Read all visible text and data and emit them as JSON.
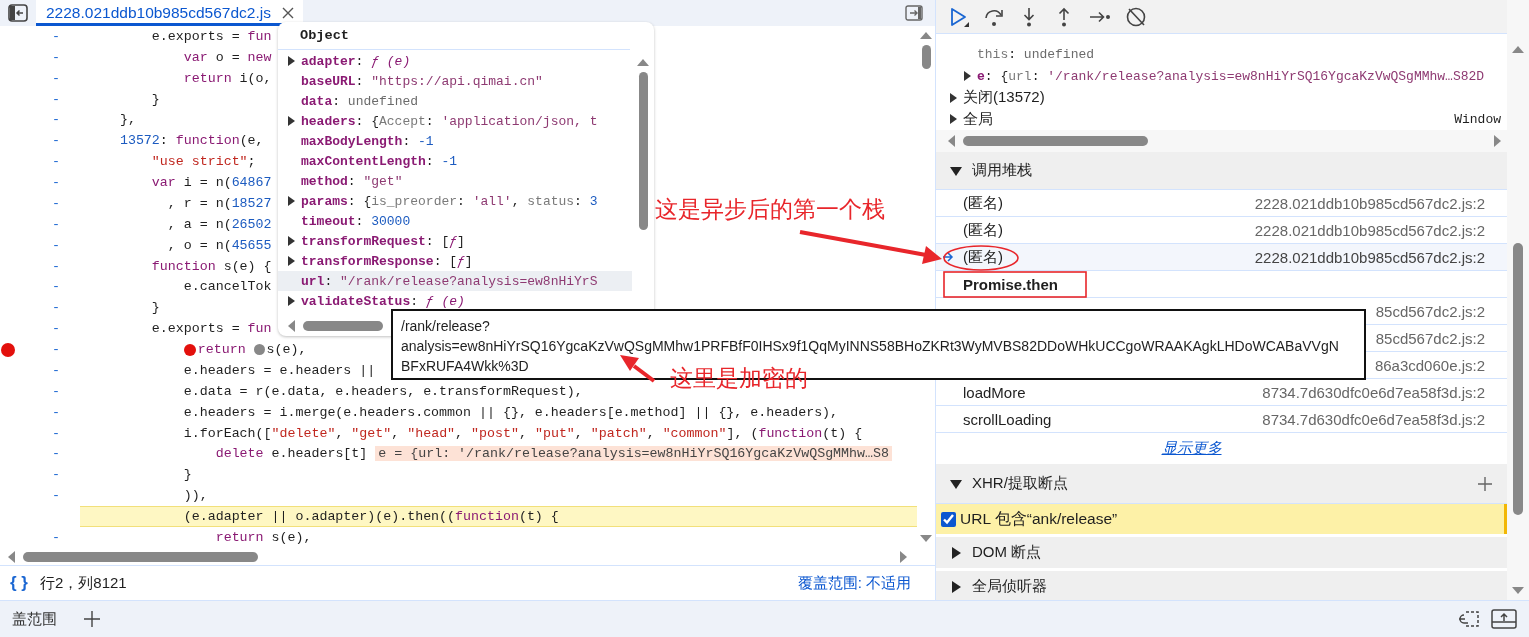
{
  "editor_tab": {
    "label": "2228.021ddb10b985cd567dc2.js",
    "selected": true
  },
  "code_lines": [
    {
      "gutter": "-",
      "current": false,
      "tokens": [
        {
          "kind": "p",
          "s": "        e.exports = "
        },
        {
          "kind": "kw",
          "s": "fun"
        }
      ]
    },
    {
      "gutter": "-",
      "current": false,
      "tokens": [
        {
          "kind": "kw",
          "s": "            var"
        },
        {
          "kind": "p",
          "s": " o = "
        },
        {
          "kind": "kw",
          "s": "new"
        }
      ]
    },
    {
      "gutter": "-",
      "current": false,
      "tokens": [
        {
          "kind": "kw",
          "s": "            return"
        },
        {
          "kind": "p",
          "s": " i(o,"
        }
      ]
    },
    {
      "gutter": "-",
      "current": false,
      "tokens": [
        {
          "kind": "p",
          "s": "        }"
        }
      ]
    },
    {
      "gutter": "-",
      "current": false,
      "tokens": [
        {
          "kind": "p",
          "s": "    },"
        }
      ]
    },
    {
      "gutter": "-",
      "current": false,
      "tokens": [
        {
          "kind": "num",
          "s": "    13572"
        },
        {
          "kind": "p",
          "s": ": "
        },
        {
          "kind": "kw",
          "s": "function"
        },
        {
          "kind": "p",
          "s": "(e,"
        }
      ]
    },
    {
      "gutter": "-",
      "current": false,
      "tokens": [
        {
          "kind": "str",
          "s": "        \"use strict\""
        },
        {
          "kind": "p",
          "s": ";"
        }
      ]
    },
    {
      "gutter": "-",
      "current": false,
      "tokens": [
        {
          "kind": "kw",
          "s": "        var"
        },
        {
          "kind": "p",
          "s": " i = n("
        },
        {
          "kind": "num",
          "s": "64867"
        }
      ]
    },
    {
      "gutter": "-",
      "current": false,
      "tokens": [
        {
          "kind": "p",
          "s": "          , r = n("
        },
        {
          "kind": "num",
          "s": "18527"
        }
      ]
    },
    {
      "gutter": "-",
      "current": false,
      "tokens": [
        {
          "kind": "p",
          "s": "          , a = n("
        },
        {
          "kind": "num",
          "s": "26502"
        }
      ]
    },
    {
      "gutter": "-",
      "current": false,
      "tokens": [
        {
          "kind": "p",
          "s": "          , o = n("
        },
        {
          "kind": "num",
          "s": "45655"
        }
      ]
    },
    {
      "gutter": "-",
      "current": false,
      "tokens": [
        {
          "kind": "kw",
          "s": "        function"
        },
        {
          "kind": "p",
          "s": " s(e) {"
        }
      ]
    },
    {
      "gutter": "-",
      "current": false,
      "tokens": [
        {
          "kind": "p",
          "s": "            e.cancelTok"
        }
      ]
    },
    {
      "gutter": "-",
      "current": false,
      "tokens": [
        {
          "kind": "p",
          "s": "        }"
        }
      ]
    },
    {
      "gutter": "-",
      "current": false,
      "tokens": [
        {
          "kind": "p",
          "s": "        e.exports = "
        },
        {
          "kind": "kw",
          "s": "fun"
        }
      ]
    },
    {
      "gutter": "-",
      "current": false,
      "tokens": [
        {
          "kind": "bp"
        },
        {
          "kind": "kw",
          "s": "return "
        },
        {
          "kind": "bpg"
        },
        {
          "kind": "p",
          "s": "s(e),"
        }
      ]
    },
    {
      "gutter": "-",
      "current": false,
      "tokens": [
        {
          "kind": "p",
          "s": "            e.headers = e.headers ||"
        }
      ]
    },
    {
      "gutter": "-",
      "current": false,
      "tokens": [
        {
          "kind": "p",
          "s": "            e.data = r(e.data, e.headers, e.transformRequest),"
        }
      ]
    },
    {
      "gutter": "-",
      "current": false,
      "tokens": [
        {
          "kind": "p",
          "s": "            e.headers = i.merge(e.headers.common || {}, e.headers[e.method] || {}, e.headers),"
        }
      ]
    },
    {
      "gutter": "-",
      "current": false,
      "tokens": [
        {
          "kind": "p",
          "s": "            i.forEach(["
        },
        {
          "kind": "str",
          "s": "\"delete\""
        },
        {
          "kind": "p",
          "s": ", "
        },
        {
          "kind": "str",
          "s": "\"get\""
        },
        {
          "kind": "p",
          "s": ", "
        },
        {
          "kind": "str",
          "s": "\"head\""
        },
        {
          "kind": "p",
          "s": ", "
        },
        {
          "kind": "str",
          "s": "\"post\""
        },
        {
          "kind": "p",
          "s": ", "
        },
        {
          "kind": "str",
          "s": "\"put\""
        },
        {
          "kind": "p",
          "s": ", "
        },
        {
          "kind": "str",
          "s": "\"patch\""
        },
        {
          "kind": "p",
          "s": ", "
        },
        {
          "kind": "str",
          "s": "\"common\""
        },
        {
          "kind": "p",
          "s": "], ("
        },
        {
          "kind": "kw",
          "s": "function"
        },
        {
          "kind": "p",
          "s": "(t) {"
        }
      ]
    },
    {
      "gutter": "-",
      "current": false,
      "tokens": [
        {
          "kind": "kw",
          "s": "                delete"
        },
        {
          "kind": "p",
          "s": " e.headers[t]"
        },
        {
          "kind": "val",
          "s": "e = {url: '/rank/release?analysis=ew8nHiYrSQ16YgcaKzVwQSgMMhw…S8"
        }
      ]
    },
    {
      "gutter": "-",
      "current": false,
      "tokens": [
        {
          "kind": "p",
          "s": "            }"
        }
      ]
    },
    {
      "gutter": "-",
      "current": false,
      "tokens": [
        {
          "kind": "p",
          "s": "            )),"
        }
      ]
    },
    {
      "current": true,
      "tokens": [
        {
          "kind": "p",
          "s": "            (e.adapter || o.adapter)(e).then(("
        },
        {
          "kind": "kw",
          "s": "function"
        },
        {
          "kind": "p",
          "s": "(t) {"
        }
      ]
    },
    {
      "gutter": "-",
      "current": false,
      "tokens": [
        {
          "kind": "kw",
          "s": "                return"
        },
        {
          "kind": "p",
          "s": " s(e),"
        }
      ]
    }
  ],
  "status_bar": {
    "pretty_print": "{ }",
    "position": "行2，列8121",
    "coverage": "覆盖范围: 不适用"
  },
  "drawer": {
    "tab": "盖范围"
  },
  "object_popover": {
    "title": "Object",
    "properties": [
      {
        "name": "adapter",
        "expandable": true,
        "selected": false,
        "tokens": [
          {
            "kind": "p",
            "s": ": "
          },
          {
            "kind": "fn",
            "s": "ƒ (e)"
          }
        ]
      },
      {
        "name": "baseURL",
        "expandable": false,
        "selected": false,
        "tokens": [
          {
            "kind": "p",
            "s": ": "
          },
          {
            "kind": "str",
            "s": "\"https://api.qimai.cn\""
          }
        ]
      },
      {
        "name": "data",
        "expandable": false,
        "selected": false,
        "tokens": [
          {
            "kind": "p",
            "s": ": "
          },
          {
            "kind": "undef",
            "s": "undefined"
          }
        ]
      },
      {
        "name": "headers",
        "expandable": true,
        "selected": false,
        "tokens": [
          {
            "kind": "p",
            "s": ": {"
          },
          {
            "kind": "key",
            "s": "Accept"
          },
          {
            "kind": "p",
            "s": ": "
          },
          {
            "kind": "str",
            "s": "'application/json, t"
          }
        ]
      },
      {
        "name": "maxBodyLength",
        "expandable": false,
        "selected": false,
        "tokens": [
          {
            "kind": "p",
            "s": ": "
          },
          {
            "kind": "num",
            "s": "-1"
          }
        ]
      },
      {
        "name": "maxContentLength",
        "expandable": false,
        "selected": false,
        "tokens": [
          {
            "kind": "p",
            "s": ": "
          },
          {
            "kind": "num",
            "s": "-1"
          }
        ]
      },
      {
        "name": "method",
        "expandable": false,
        "selected": false,
        "tokens": [
          {
            "kind": "p",
            "s": ": "
          },
          {
            "kind": "str",
            "s": "\"get\""
          }
        ]
      },
      {
        "name": "params",
        "expandable": true,
        "selected": false,
        "tokens": [
          {
            "kind": "p",
            "s": ": {"
          },
          {
            "kind": "key",
            "s": "is_preorder"
          },
          {
            "kind": "p",
            "s": ": "
          },
          {
            "kind": "str",
            "s": "'all'"
          },
          {
            "kind": "p",
            "s": ", "
          },
          {
            "kind": "key",
            "s": "status"
          },
          {
            "kind": "p",
            "s": ": "
          },
          {
            "kind": "num",
            "s": "3"
          }
        ]
      },
      {
        "name": "timeout",
        "expandable": false,
        "selected": false,
        "tokens": [
          {
            "kind": "p",
            "s": ": "
          },
          {
            "kind": "num",
            "s": "30000"
          }
        ]
      },
      {
        "name": "transformRequest",
        "expandable": true,
        "selected": false,
        "tokens": [
          {
            "kind": "p",
            "s": ": ["
          },
          {
            "kind": "fn",
            "s": "ƒ"
          },
          {
            "kind": "p",
            "s": "]"
          }
        ]
      },
      {
        "name": "transformResponse",
        "expandable": true,
        "selected": false,
        "tokens": [
          {
            "kind": "p",
            "s": ": ["
          },
          {
            "kind": "fn",
            "s": "ƒ"
          },
          {
            "kind": "p",
            "s": "]"
          }
        ]
      },
      {
        "name": "url",
        "expandable": false,
        "selected": true,
        "tokens": [
          {
            "kind": "p",
            "s": ": "
          },
          {
            "kind": "str",
            "s": "\"/rank/release?analysis=ew8nHiYrS"
          }
        ]
      },
      {
        "name": "validateStatus",
        "expandable": true,
        "selected": false,
        "tokens": [
          {
            "kind": "p",
            "s": ": "
          },
          {
            "kind": "fn",
            "s": "ƒ (e)"
          }
        ]
      }
    ]
  },
  "scope": [
    {
      "kind": "value",
      "name": "this",
      "expandable": false,
      "tokens": [
        {
          "kind": "p",
          "s": ": "
        },
        {
          "kind": "undef",
          "s": "undefined"
        }
      ]
    },
    {
      "kind": "value",
      "name": "e",
      "expandable": true,
      "tokens": [
        {
          "kind": "p",
          "s": ": {"
        },
        {
          "kind": "key",
          "s": "url"
        },
        {
          "kind": "p",
          "s": ": "
        },
        {
          "kind": "str",
          "s": "'/rank/release?analysis=ew8nHiYrSQ16YgcaKzVwQSgMMhw…S82D"
        }
      ]
    },
    {
      "kind": "scope",
      "label": "关闭(13572)",
      "expandable": true
    },
    {
      "kind": "scope",
      "label": "全局",
      "value": "Window",
      "expandable": true
    }
  ],
  "call_stack": {
    "title": "调用堆栈",
    "expanded": true,
    "frames": [
      {
        "kind": "frame",
        "name": "(匿名)",
        "location": "2228.021ddb10b985cd567dc2.js:2",
        "selected": false
      },
      {
        "kind": "frame",
        "name": "(匿名)",
        "location": "2228.021ddb10b985cd567dc2.js:2",
        "selected": false
      },
      {
        "kind": "frame",
        "name": "(匿名)",
        "location": "2228.021ddb10b985cd567dc2.js:2",
        "selected": true
      },
      {
        "kind": "async",
        "name": "Promise.then"
      },
      {
        "kind": "frame",
        "location": "85cd567dc2.js:2",
        "selected": false
      },
      {
        "kind": "frame",
        "location": "85cd567dc2.js:2",
        "selected": false
      },
      {
        "kind": "frame",
        "location": "86a3cd060e.js:2",
        "selected": false
      },
      {
        "kind": "frame",
        "name": "loadMore",
        "location": "8734.7d630dfc0e6d7ea58f3d.js:2",
        "selected": false
      },
      {
        "kind": "frame",
        "name": "scrollLoading",
        "location": "8734.7d630dfc0e6d7ea58f3d.js:2",
        "selected": false
      }
    ],
    "show_more": "显示更多"
  },
  "xhr_breakpoints": {
    "title": "XHR/提取断点",
    "expanded": true,
    "items": [
      {
        "label": "URL 包含“ank/release”",
        "checked": true,
        "hit": true
      }
    ]
  },
  "dom_breakpoints": {
    "title": "DOM 断点",
    "expanded": false
  },
  "global_listeners": {
    "title": "全局侦听器",
    "expanded": false
  },
  "url_tooltip": {
    "lines": [
      "/rank/release?",
      "analysis=ew8nHiYrSQ16YgcaKzVwQSgMMhw1PRFBfF0IHSx9f1QqMyINNS58BHoZKRt3WyMVBS82DDoWHkUCCgoWRAAKAgkLHDoWCABaVVgN",
      "BFxRUFA4Wkk%3D"
    ]
  },
  "annotations": [
    {
      "text": "这是异步后的第一个栈"
    },
    {
      "text": "这里是加密的"
    }
  ]
}
